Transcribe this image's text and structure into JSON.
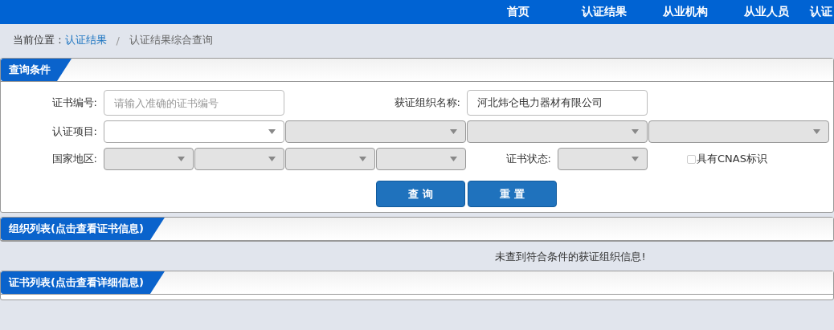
{
  "nav": [
    {
      "label": "首页"
    },
    {
      "label": "认证结果"
    },
    {
      "label": "从业机构"
    },
    {
      "label": "从业人员"
    },
    {
      "label": "认证"
    }
  ],
  "breadcrumb": {
    "prefix": "当前位置 :",
    "link": "认证结果",
    "separator": "/",
    "current": "认证结果综合查询"
  },
  "query_panel": {
    "title": "查询条件",
    "cert_number": {
      "label": "证书编号:",
      "placeholder": "请输入准确的证书编号"
    },
    "org_name": {
      "label": "获证组织名称:",
      "value": "河北炜仑电力器材有限公司"
    },
    "project": {
      "label": "认证项目:",
      "selects": [
        {
          "disabled": false
        },
        {
          "disabled": true
        },
        {
          "disabled": true
        },
        {
          "disabled": true
        }
      ]
    },
    "region": {
      "label": "国家地区:",
      "selects": [
        {
          "disabled": true
        },
        {
          "disabled": true
        },
        {
          "disabled": true
        },
        {
          "disabled": true
        }
      ]
    },
    "status": {
      "label": "证书状态:",
      "disabled": true
    },
    "cnas": {
      "label": "具有CNAS标识",
      "checked": false
    },
    "buttons": [
      "查 询",
      "重 置"
    ]
  },
  "org_list": {
    "title": "组织列表(点击查看证书信息)",
    "message": "未查到符合条件的获证组织信息!"
  },
  "cert_list": {
    "title": "证书列表(点击查看详细信息)"
  }
}
